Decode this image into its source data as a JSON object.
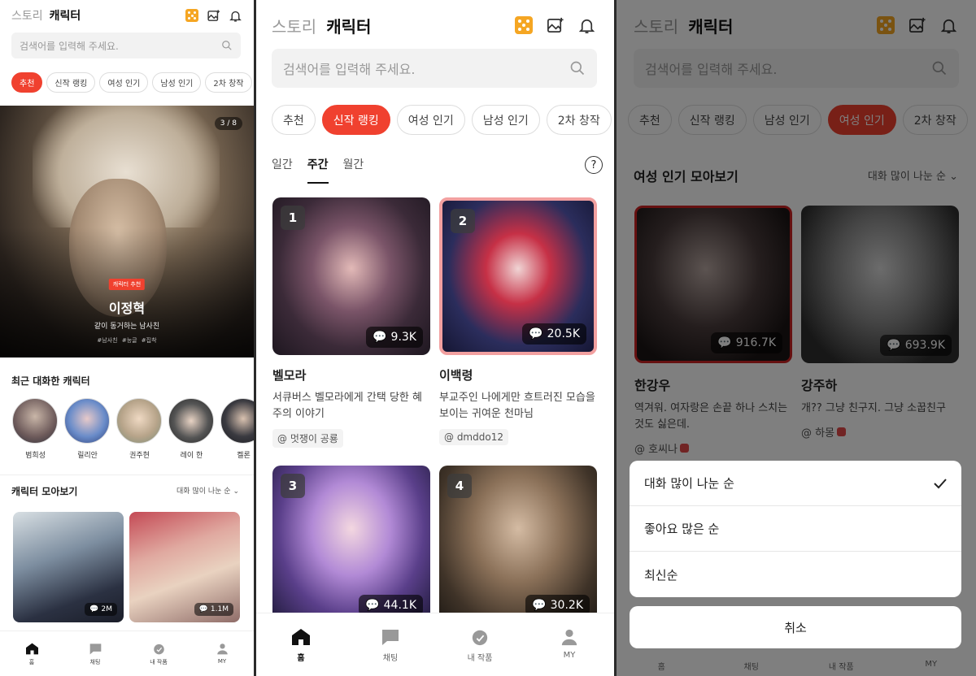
{
  "header": {
    "story_tab": "스토리",
    "character_tab": "캐릭터"
  },
  "search": {
    "placeholder": "검색어를 입력해 주세요."
  },
  "chips": [
    "추천",
    "신작 랭킹",
    "여성 인기",
    "남성 인기",
    "2차 창작"
  ],
  "chips_p3": [
    "추천",
    "신작 랭킹",
    "남성 인기",
    "여성 인기",
    "2차 창작"
  ],
  "nav": {
    "home": "홈",
    "chat": "채팅",
    "my_works": "내 작품",
    "my": "MY"
  },
  "colors": {
    "accent": "#f0412f",
    "dice": "#f5a623"
  },
  "p1": {
    "hero": {
      "pager": "3 / 8",
      "badge": "캐릭터 추천",
      "name": "이정혁",
      "subtitle": "같이 동거하는 남사친",
      "tags": "#남사친 #능글 #집착"
    },
    "recent_title": "최근 대화한 캐릭터",
    "recent": [
      {
        "name": "범희성"
      },
      {
        "name": "릴리안"
      },
      {
        "name": "권주현"
      },
      {
        "name": "레이 한"
      },
      {
        "name": "켈론"
      }
    ],
    "collection_title": "캐릭터 모아보기",
    "sort_label": "대화 많이 나눈 순",
    "cards": [
      {
        "count": "2M"
      },
      {
        "count": "1.1M"
      }
    ]
  },
  "p2": {
    "periods": [
      "일간",
      "주간",
      "월간"
    ],
    "items": [
      {
        "rank": "1",
        "count": "9.3K",
        "name": "벨모라",
        "desc": "서큐버스 벨모라에게 간택 당한 혜주의 이야기",
        "author": "@ 멋쟁이 공룡"
      },
      {
        "rank": "2",
        "count": "20.5K",
        "name": "이백령",
        "desc": "부교주인 나에게만 흐트러진 모습을 보이는 귀여운 천마님",
        "author": "@ dmddo12"
      },
      {
        "rank": "3",
        "count": "44.1K"
      },
      {
        "rank": "4",
        "count": "30.2K"
      }
    ]
  },
  "p3": {
    "section_title": "여성 인기 모아보기",
    "sort_label": "대화 많이 나눈 순",
    "items": [
      {
        "count": "916.7K",
        "name": "한강우",
        "desc": "역겨워. 여자랑은 손끝 하나 스치는 것도 싫은데.",
        "author": "@ 호씨나"
      },
      {
        "count": "693.9K",
        "name": "강주하",
        "desc": "개?? 그냥 친구지. 그냥 소꿉친구",
        "author": "@ 하몽"
      }
    ],
    "sheet": {
      "options": [
        "대화 많이 나눈 순",
        "좋아요 많은 순",
        "최신순"
      ],
      "selected_index": 0,
      "cancel": "취소"
    }
  }
}
